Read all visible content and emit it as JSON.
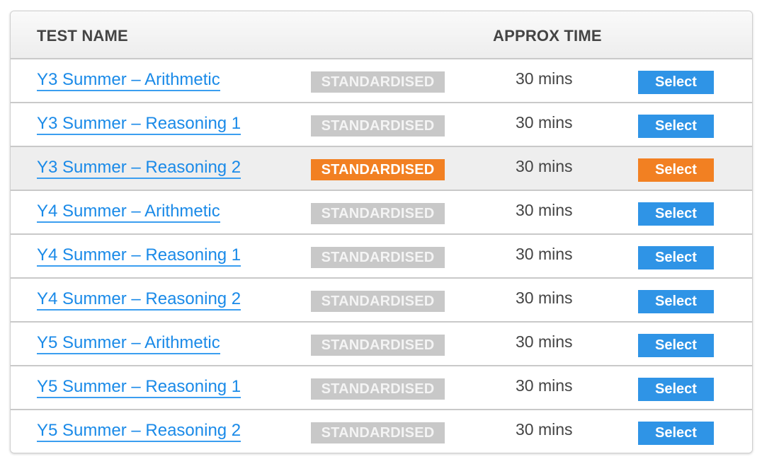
{
  "table": {
    "headers": {
      "test_name": "TEST NAME",
      "type": "",
      "approx_time": "APPROX TIME",
      "action": ""
    },
    "rows": [
      {
        "name": "Y3 Summer – Arithmetic",
        "badge": "STANDARDISED",
        "time": "30 mins",
        "action": "Select",
        "highlighted": false
      },
      {
        "name": "Y3 Summer – Reasoning 1",
        "badge": "STANDARDISED",
        "time": "30 mins",
        "action": "Select",
        "highlighted": false
      },
      {
        "name": "Y3 Summer – Reasoning 2",
        "badge": "STANDARDISED",
        "time": "30 mins",
        "action": "Select",
        "highlighted": true
      },
      {
        "name": "Y4 Summer – Arithmetic",
        "badge": "STANDARDISED",
        "time": "30 mins",
        "action": "Select",
        "highlighted": false
      },
      {
        "name": "Y4 Summer – Reasoning 1",
        "badge": "STANDARDISED",
        "time": "30 mins",
        "action": "Select",
        "highlighted": false
      },
      {
        "name": "Y4 Summer – Reasoning 2",
        "badge": "STANDARDISED",
        "time": "30 mins",
        "action": "Select",
        "highlighted": false
      },
      {
        "name": "Y5 Summer – Arithmetic",
        "badge": "STANDARDISED",
        "time": "30 mins",
        "action": "Select",
        "highlighted": false
      },
      {
        "name": "Y5 Summer – Reasoning 1",
        "badge": "STANDARDISED",
        "time": "30 mins",
        "action": "Select",
        "highlighted": false
      },
      {
        "name": "Y5 Summer – Reasoning 2",
        "badge": "STANDARDISED",
        "time": "30 mins",
        "action": "Select",
        "highlighted": false
      }
    ]
  },
  "colors": {
    "link": "#1a8ae8",
    "button": "#2f94e6",
    "highlight_accent": "#f28022",
    "badge_inactive": "#c8c8c8",
    "row_highlight_bg": "#eeeeee"
  }
}
